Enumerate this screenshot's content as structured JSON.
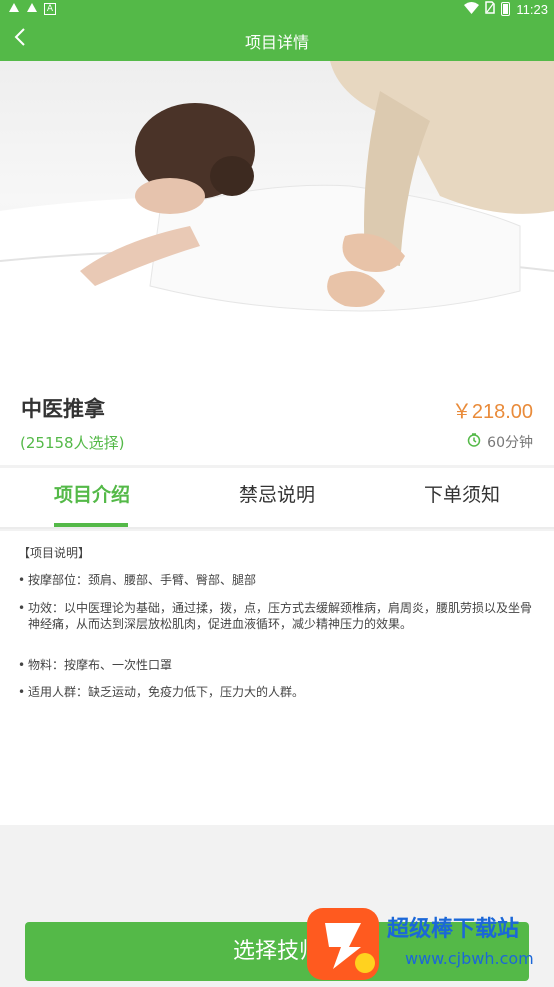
{
  "status_bar": {
    "left_icons": [
      "app-icon-a",
      "app-icon-b",
      "notification-a-icon"
    ],
    "time": "11:23",
    "right_icons": [
      "wifi-icon",
      "no-sim-icon",
      "battery-icon"
    ]
  },
  "app_bar": {
    "title": "项目详情",
    "back_icon": "chevron-left-icon"
  },
  "hero": {
    "description_icon": "massage-photo"
  },
  "service": {
    "name": "中医推拿",
    "price": "￥218.00",
    "selected_count": "(25158人选择)",
    "duration": "60分钟"
  },
  "tabs": [
    {
      "label": "项目介绍",
      "active": true
    },
    {
      "label": "禁忌说明",
      "active": false
    },
    {
      "label": "下单须知",
      "active": false
    }
  ],
  "content": {
    "heading": "【项目说明】",
    "items": [
      "按摩部位：颈肩、腰部、手臂、臀部、腿部",
      "功效：以中医理论为基础，通过揉，拨，点，压方式去缓解颈椎病，肩周炎，腰肌劳损以及坐骨神经痛，从而达到深层放松肌肉，促进血液循环，减少精神压力的效果。",
      "物料：按摩布、一次性口罩",
      "适用人群：缺乏运动，免疫力低下，压力大的人群。"
    ]
  },
  "bottom": {
    "button_label": "选择技师"
  },
  "watermark": {
    "text": "超级棒下载站",
    "url": "www.cjbwh.com"
  },
  "colors": {
    "primary": "#54b948",
    "price": "#e98b3a"
  }
}
